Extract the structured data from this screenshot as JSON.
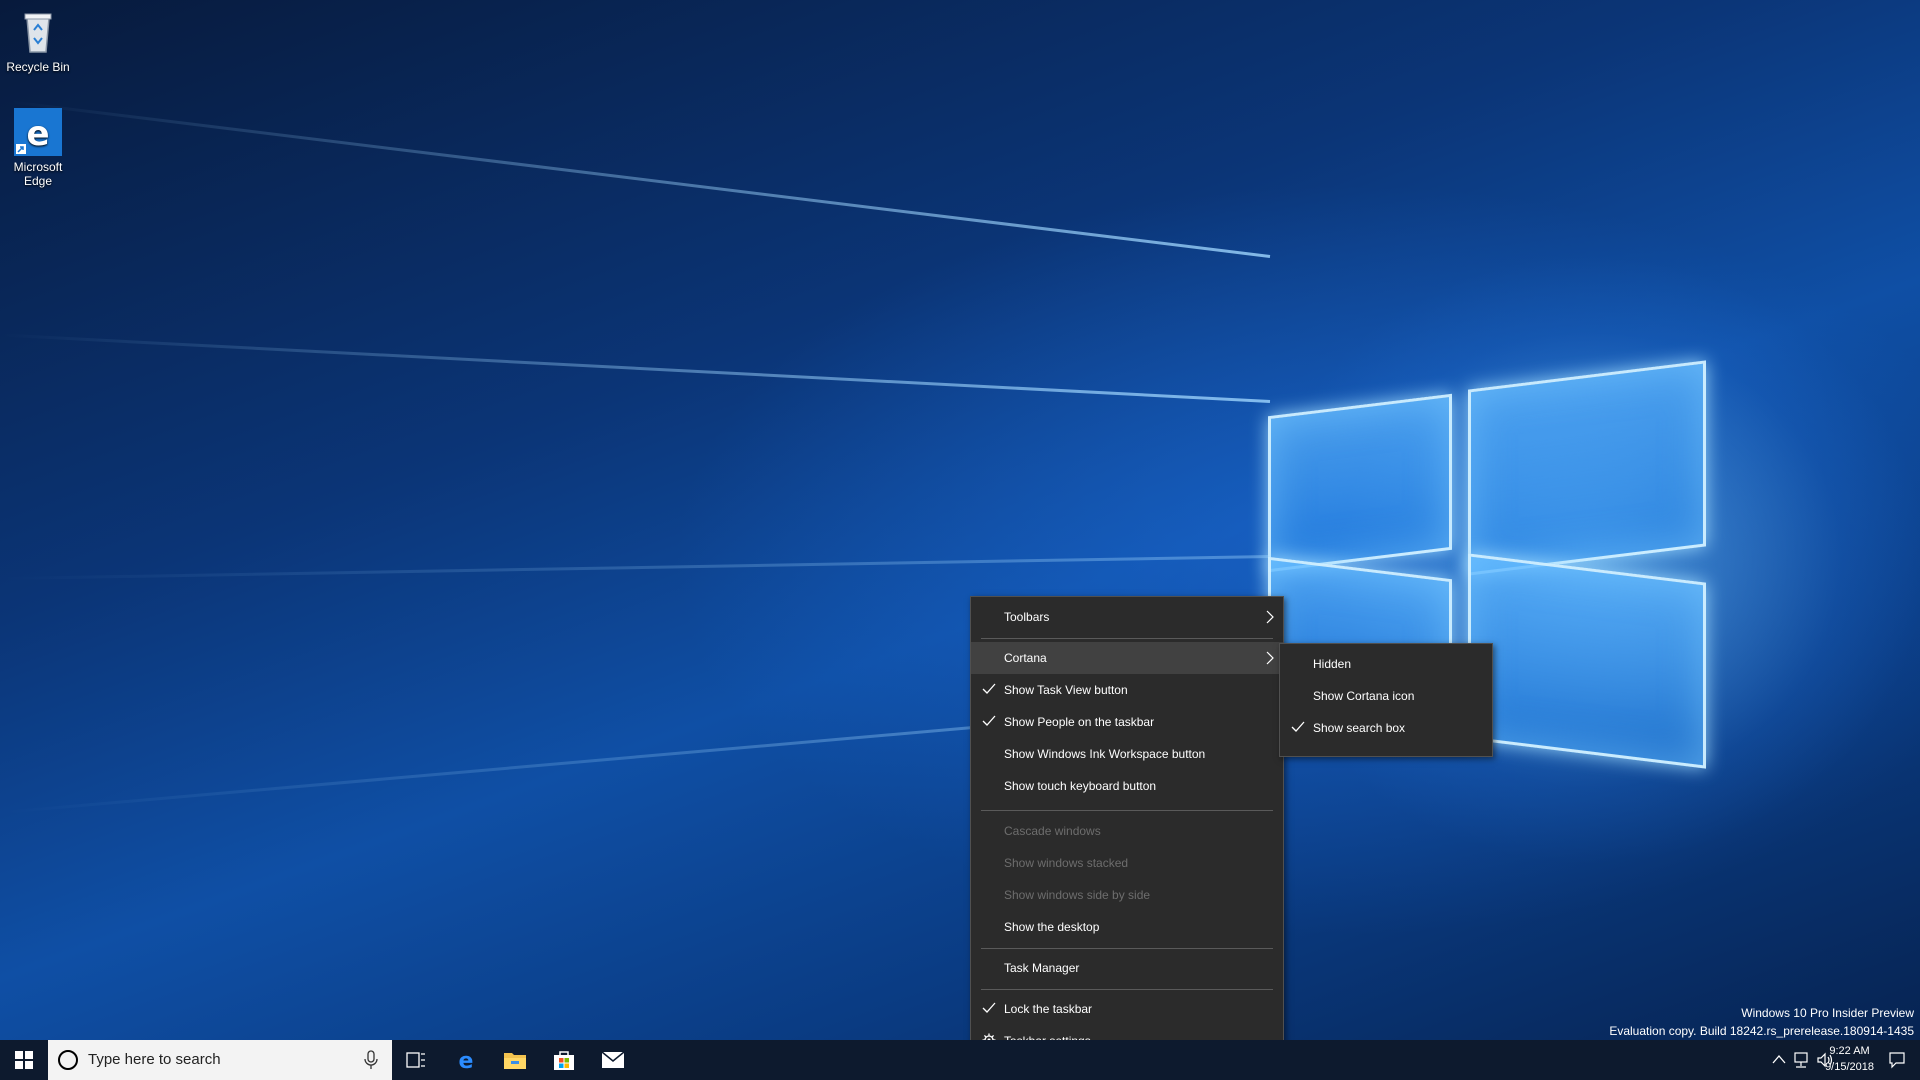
{
  "desktop": {
    "icons": [
      {
        "label": "Recycle Bin",
        "icon": "recycle-bin-icon"
      },
      {
        "label": "Microsoft Edge",
        "icon": "edge-icon"
      }
    ]
  },
  "taskbar": {
    "search_placeholder": "Type here to search",
    "pinned": [
      "task-view-icon",
      "edge-icon",
      "file-explorer-icon",
      "store-icon",
      "mail-icon"
    ]
  },
  "context_menu": {
    "items": [
      {
        "label": "Toolbars",
        "has_submenu": true
      },
      {
        "label": "Cortana",
        "has_submenu": true,
        "highlighted": true
      },
      {
        "label": "Show Task View button",
        "checked": true
      },
      {
        "label": "Show People on the taskbar",
        "checked": true
      },
      {
        "label": "Show Windows Ink Workspace button"
      },
      {
        "label": "Show touch keyboard button"
      },
      {
        "label": "Cascade windows",
        "disabled": true
      },
      {
        "label": "Show windows stacked",
        "disabled": true
      },
      {
        "label": "Show windows side by side",
        "disabled": true
      },
      {
        "label": "Show the desktop"
      },
      {
        "label": "Task Manager"
      },
      {
        "label": "Lock the taskbar",
        "checked": true
      },
      {
        "label": "Taskbar settings",
        "icon": "gear-icon"
      }
    ]
  },
  "cortana_submenu": {
    "items": [
      {
        "label": "Hidden"
      },
      {
        "label": "Show Cortana icon"
      },
      {
        "label": "Show search box",
        "checked": true
      }
    ]
  },
  "watermark": {
    "line1": "Windows 10 Pro Insider Preview",
    "line2": "Evaluation copy. Build 18242.rs_prerelease.180914-1435"
  },
  "clock": {
    "time": "9:22 AM",
    "date": "9/15/2018"
  },
  "colors": {
    "menu_bg": "#2b2b2b",
    "menu_highlight": "#414141",
    "taskbar_bg": "#0d1a2e",
    "disabled_text": "#6d6d6d"
  }
}
